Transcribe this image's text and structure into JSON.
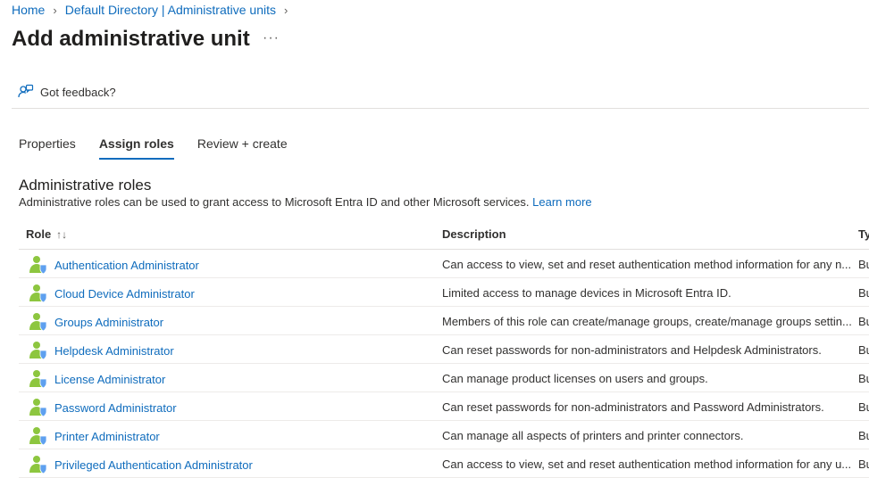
{
  "breadcrumb": {
    "items": [
      "Home",
      "Default Directory | Administrative units"
    ]
  },
  "page": {
    "title": "Add administrative unit",
    "more": "···"
  },
  "feedback": {
    "label": "Got feedback?"
  },
  "tabs": [
    {
      "label": "Properties",
      "active": false
    },
    {
      "label": "Assign roles",
      "active": true
    },
    {
      "label": "Review + create",
      "active": false
    }
  ],
  "section": {
    "title": "Administrative roles",
    "description": "Administrative roles can be used to grant access to Microsoft Entra ID and other Microsoft services.",
    "learn_more": "Learn more"
  },
  "table": {
    "columns": {
      "role": "Role",
      "description": "Description",
      "type": "Ty"
    },
    "rows": [
      {
        "role": "Authentication Administrator",
        "description": "Can access to view, set and reset authentication method information for any n...",
        "type": "Bu"
      },
      {
        "role": "Cloud Device Administrator",
        "description": "Limited access to manage devices in Microsoft Entra ID.",
        "type": "Bu"
      },
      {
        "role": "Groups Administrator",
        "description": "Members of this role can create/manage groups, create/manage groups settin...",
        "type": "Bu"
      },
      {
        "role": "Helpdesk Administrator",
        "description": "Can reset passwords for non-administrators and Helpdesk Administrators.",
        "type": "Bu"
      },
      {
        "role": "License Administrator",
        "description": "Can manage product licenses on users and groups.",
        "type": "Bu"
      },
      {
        "role": "Password Administrator",
        "description": "Can reset passwords for non-administrators and Password Administrators.",
        "type": "Bu"
      },
      {
        "role": "Printer Administrator",
        "description": "Can manage all aspects of printers and printer connectors.",
        "type": "Bu"
      },
      {
        "role": "Privileged Authentication Administrator",
        "description": "Can access to view, set and reset authentication method information for any u...",
        "type": "Bu"
      }
    ]
  },
  "colors": {
    "link": "#0f6cbd",
    "role_icon_person": "#8dc63f",
    "role_icon_badge": "#5ea0ef"
  }
}
